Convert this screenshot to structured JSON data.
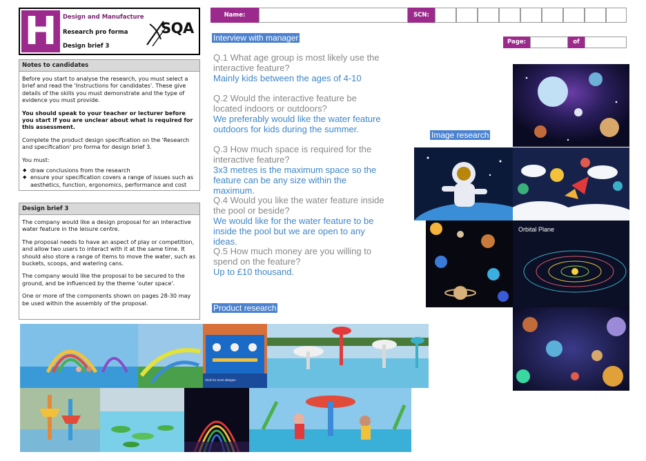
{
  "header": {
    "letter": "H",
    "line1": "Design and Manufacture",
    "line2": "Research pro forma",
    "line3": "Design brief 3",
    "logo_text": "SQA"
  },
  "notes": {
    "title": "Notes to candidates",
    "p1": "Before you start to analyse the research, you must select a brief and read the 'Instructions for candidates'. These give details of the skills you must demonstrate and the type of evidence you must provide.",
    "p2": "You should speak to your teacher or lecturer before you start if you are unclear about what is required for this assessment.",
    "p3": "Complete the product design specification on the 'Research and specification' pro forma for design brief 3.",
    "p4": "You must:",
    "bullets": [
      "draw conclusions from the research",
      "ensure your specification covers a range of issues such as aesthetics, function, ergonomics, performance and cost"
    ]
  },
  "brief": {
    "title": "Design brief 3",
    "p1": "The company would like a design proposal for an interactive water feature in the leisure centre.",
    "p2": "The proposal needs to have an aspect of play or competition, and allow two users to interact with it at the same time. It should also store a range of items to move the water, such as buckets, scoops, and watering cans.",
    "p3": "The company would like the proposal to be secured to the ground, and be influenced by the theme 'outer space'.",
    "p4": "One or more of the components shown on pages 28-30 may be used within the assembly of the proposal."
  },
  "form": {
    "name_label": "Name:",
    "name_value": "",
    "scn_label": "SCN:",
    "page_label": "Page:",
    "page_value": "",
    "of_label": "of",
    "of_value": ""
  },
  "sections": {
    "interview": "Interview with manager",
    "image_research": "Image research",
    "product_research": "Product research"
  },
  "questions": [
    {
      "q": "Q.1 What age group is most likely use the interactive feature?",
      "a": "Mainly kids between the ages of 4-10"
    },
    {
      "q": "Q.2 Would the interactive feature be located indoors or outdoors?",
      "a": "We preferably would like the water feature outdoors for kids during the summer."
    },
    {
      "q": "Q.3 How much space is required for the interactive feature?",
      "a": "3x3 metres is the maximum space so the feature can be any size within the maximum."
    },
    {
      "q": "Q.4 Would you like the water feature inside the pool or beside?",
      "a": "We would like for the water feature to be inside the pool but we are open to any ideas."
    },
    {
      "q": "Q.5 How much money are you willing to spend on the feature?",
      "a": "Up to £10 thousand."
    }
  ],
  "image_captions": {
    "orbital": "Orbital Plane",
    "blue_wall": "Click for more designs"
  },
  "colors": {
    "brand_purple": "#9b2a8c",
    "highlight_blue": "#4a82cf",
    "answer_blue": "#3e86c7",
    "question_grey": "#888888"
  }
}
